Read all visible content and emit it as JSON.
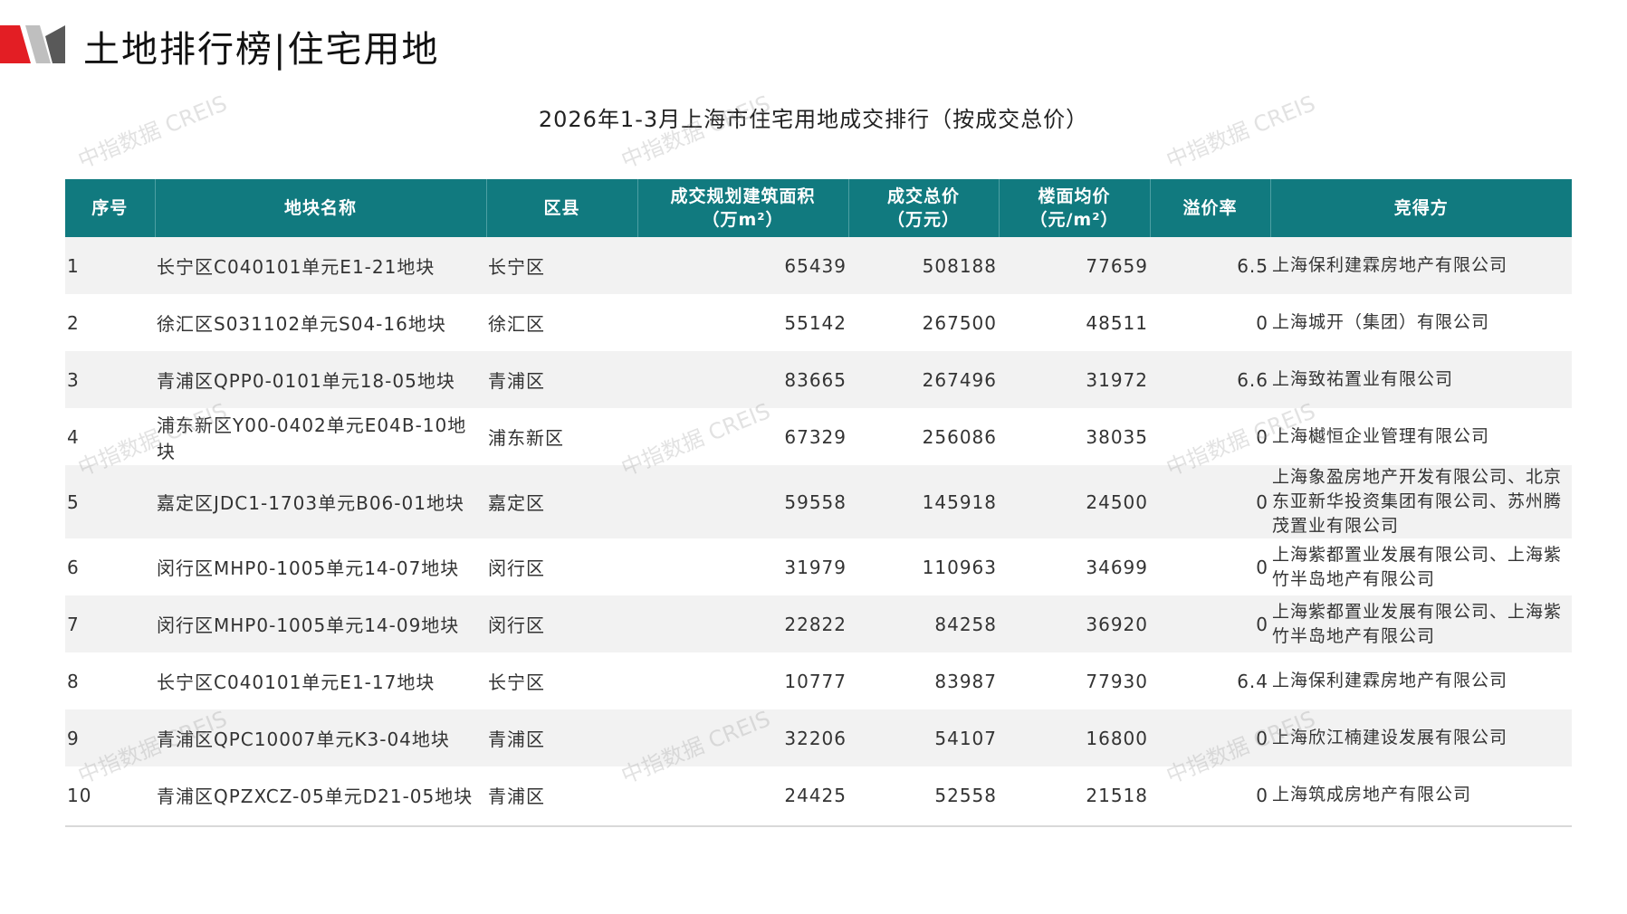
{
  "page": {
    "title": "土地排行榜|住宅用地",
    "watermark": "中指数据 CREIS"
  },
  "table": {
    "title": "2026年1-3月上海市住宅用地成交排行（按成交总价）",
    "headers": {
      "index": "序号",
      "plot_name": "地块名称",
      "district": "区县",
      "area_l1": "成交规划建筑面积",
      "area_l2": "（万m²）",
      "total_l1": "成交总价",
      "total_l2": "（万元）",
      "unit_l1": "楼面均价",
      "unit_l2": "（元/m²）",
      "premium": "溢价率",
      "winner": "竞得方"
    },
    "rows": [
      {
        "index": "1",
        "plot_name": "长宁区C040101单元E1-21地块",
        "district": "长宁区",
        "area": "65439",
        "total": "508188",
        "unit_price": "77659",
        "premium": "6.5",
        "winner": "上海保利建霖房地产有限公司"
      },
      {
        "index": "2",
        "plot_name": "徐汇区S031102单元S04-16地块",
        "district": "徐汇区",
        "area": "55142",
        "total": "267500",
        "unit_price": "48511",
        "premium": "0",
        "winner": "上海城开（集团）有限公司"
      },
      {
        "index": "3",
        "plot_name": "青浦区QPP0-0101单元18-05地块",
        "district": "青浦区",
        "area": "83665",
        "total": "267496",
        "unit_price": "31972",
        "premium": "6.6",
        "winner": "上海致祐置业有限公司"
      },
      {
        "index": "4",
        "plot_name": "浦东新区Y00-0402单元E04B-10地块",
        "district": "浦东新区",
        "area": "67329",
        "total": "256086",
        "unit_price": "38035",
        "premium": "0",
        "winner": "上海樾恒企业管理有限公司"
      },
      {
        "index": "5",
        "plot_name": "嘉定区JDC1-1703单元B06-01地块",
        "district": "嘉定区",
        "area": "59558",
        "total": "145918",
        "unit_price": "24500",
        "premium": "0",
        "winner": "上海象盈房地产开发有限公司、北京东亚新华投资集团有限公司、苏州腾茂置业有限公司"
      },
      {
        "index": "6",
        "plot_name": "闵行区MHP0-1005单元14-07地块",
        "district": "闵行区",
        "area": "31979",
        "total": "110963",
        "unit_price": "34699",
        "premium": "0",
        "winner": "上海紫都置业发展有限公司、上海紫竹半岛地产有限公司"
      },
      {
        "index": "7",
        "plot_name": "闵行区MHP0-1005单元14-09地块",
        "district": "闵行区",
        "area": "22822",
        "total": "84258",
        "unit_price": "36920",
        "premium": "0",
        "winner": "上海紫都置业发展有限公司、上海紫竹半岛地产有限公司"
      },
      {
        "index": "8",
        "plot_name": "长宁区C040101单元E1-17地块",
        "district": "长宁区",
        "area": "10777",
        "total": "83987",
        "unit_price": "77930",
        "premium": "6.4",
        "winner": "上海保利建霖房地产有限公司"
      },
      {
        "index": "9",
        "plot_name": "青浦区QPC10007单元K3-04地块",
        "district": "青浦区",
        "area": "32206",
        "total": "54107",
        "unit_price": "16800",
        "premium": "0",
        "winner": "上海欣江楠建设发展有限公司"
      },
      {
        "index": "10",
        "plot_name": "青浦区QPZXCZ-05单元D21-05地块",
        "district": "青浦区",
        "area": "24425",
        "total": "52558",
        "unit_price": "21518",
        "premium": "0",
        "winner": "上海筑成房地产有限公司"
      }
    ]
  },
  "colors": {
    "header_bg": "#117a7f",
    "header_text": "#ffffff",
    "total_price_text": "#c00000",
    "stripe": "#f2f2f2",
    "logo_red": "#e31e24",
    "logo_gray": "#595959"
  }
}
